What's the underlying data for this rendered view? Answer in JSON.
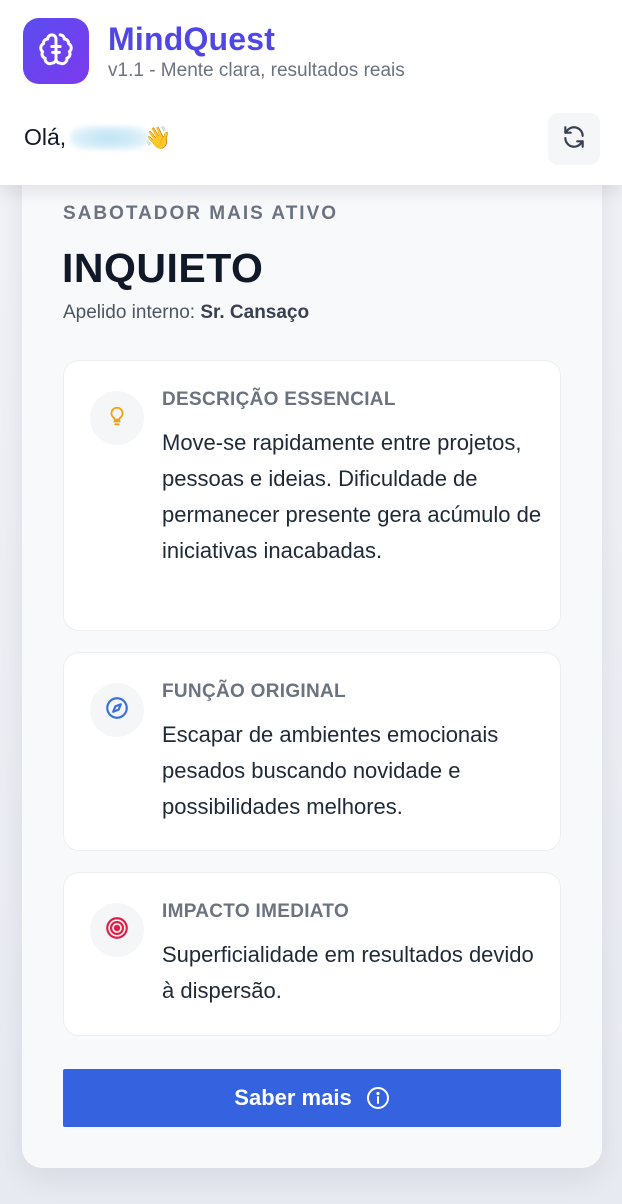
{
  "header": {
    "app_name": "MindQuest",
    "subtitle": "v1.1 - Mente clara, resultados reais",
    "greeting": "Olá,",
    "user_name_blurred": "",
    "wave": "👋",
    "logo_icon": "brain-icon",
    "refresh_icon": "refresh-icon"
  },
  "card": {
    "section_label": "SABOTADOR MAIS ATIVO",
    "title": "INQUIETO",
    "nickname_label": "Apelido interno:",
    "nickname_value": "Sr. Cansaço",
    "sections": [
      {
        "icon": "lightbulb-icon",
        "icon_color": "#f59e0b",
        "heading": "DESCRIÇÃO ESSENCIAL",
        "text": "Move-se rapidamente entre projetos, pessoas e ideias. Dificuldade de permanecer presente gera acúmulo de iniciativas inacabadas."
      },
      {
        "icon": "compass-icon",
        "icon_color": "#3b6fe0",
        "heading": "FUNÇÃO ORIGINAL",
        "text": "Escapar de ambientes emocionais pesados buscando novidade e possibilidades melhores."
      },
      {
        "icon": "target-icon",
        "icon_color": "#e11d48",
        "heading": "IMPACTO IMEDIATO",
        "text": "Superficialidade em resultados devido à dispersão."
      }
    ],
    "cta_label": "Saber mais",
    "cta_icon": "info-icon"
  },
  "colors": {
    "brand": "#4f46e5",
    "button": "#3563e0"
  }
}
